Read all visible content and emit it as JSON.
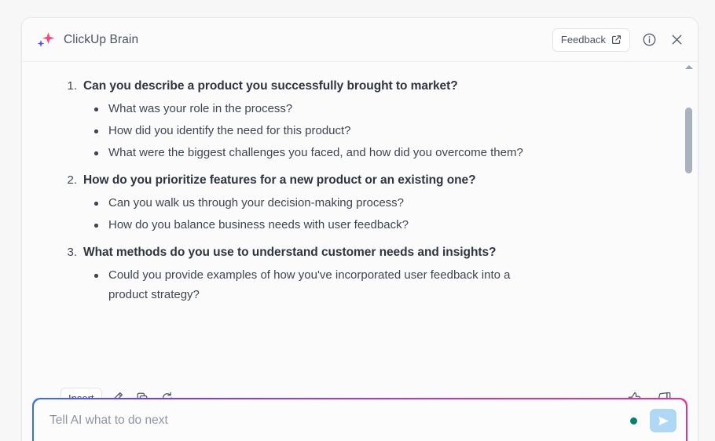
{
  "header": {
    "title": "ClickUp Brain",
    "logo_icon": "sparkle-icon",
    "feedback_label": "Feedback",
    "feedback_icon": "external-link-icon",
    "info_icon": "info-circle-icon",
    "close_icon": "close-icon"
  },
  "message": {
    "questions": [
      {
        "number": "1.",
        "heading": "Can you describe a product you successfully brought to market?",
        "subpoints": [
          "What was your role in the process?",
          "How did you identify the need for this product?",
          "What were the biggest challenges you faced, and how did you overcome them?"
        ]
      },
      {
        "number": "2.",
        "heading": "How do you prioritize features for a new product or an existing one?",
        "subpoints": [
          "Can you walk us through your decision-making process?",
          "How do you balance business needs with user feedback?"
        ]
      },
      {
        "number": "3.",
        "heading": "What methods do you use to understand customer needs and insights?",
        "subpoints": [
          "Could you provide examples of how you've incorporated user feedback into a product strategy?"
        ]
      }
    ]
  },
  "toolbar": {
    "insert_label": "Insert",
    "edit_icon": "pencil-icon",
    "copy_icon": "copy-icon",
    "retry_icon": "refresh-icon",
    "thumbs_up_icon": "thumbs-up-icon",
    "thumbs_down_icon": "thumbs-down-icon"
  },
  "composer": {
    "placeholder": "Tell AI what to do next",
    "value": "",
    "status_dot_color": "#05816d",
    "send_icon": "send-icon"
  },
  "scrollbar": {
    "up_arrow_icon": "caret-up-icon"
  },
  "colors": {
    "panel_bg": "#fbfbfc",
    "border": "#e6e7ea",
    "text": "#3e4551",
    "heading": "#2f353f",
    "gradient_start": "#3b6cf6",
    "gradient_end": "#e0329a",
    "send_button": "#aed8f4"
  }
}
